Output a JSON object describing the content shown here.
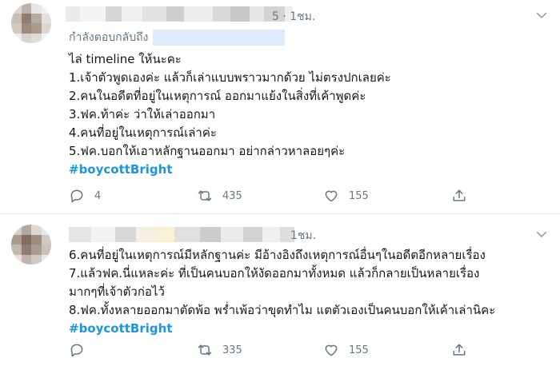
{
  "tweets": [
    {
      "time": "5 · 1ชม.",
      "replying_to": "กำลังตอบกลับถึง",
      "lines": [
        "ไล่ timeline ให้นะคะ",
        "1.เจ้าตัวพูดเองค่ะ แล้วก็เล่าแบบพราวมากด้วย ไม่ตรงปกเลยค่ะ",
        "2.คนในอดีตที่อยู่ในเหตุการณ์ ออกมาแย้งในสิ่งที่เค้าพูดค่ะ",
        "3.ฟค.ท้าค่ะ ว่าให้เล่าออกมา",
        "4.คนที่อยู่ในเหตุการณ์เล่าค่ะ",
        "5.ฟค.บอกให้เอาหลักฐานออกมา อย่ากล่าวหาลอยๆค่ะ"
      ],
      "hashtag": "#boycottBright",
      "reply_count": "4",
      "retweet_count": "435",
      "like_count": "155",
      "icons": {
        "reply": "reply-icon",
        "retweet": "retweet-icon",
        "like": "heart-icon",
        "share": "share-icon",
        "menu": "chevron-down-icon"
      }
    },
    {
      "time": "1ชม.",
      "lines": [
        "6.คนที่อยู่ในเหตุการณ์มีหลักฐานค่ะ มีอ้างอิงถึงเหตุการณ์อื่นๆในอดีตอีกหลายเรื่อง",
        "7.แล้วฟค.นี่แหละค่ะ ที่เป็นคนบอกให้งัดออกมาทั้งหมด แล้วก็กลายเป็นหลายเรื่อง",
        "มากๆที่เจ้าตัวก่อไว้",
        "8.ฟค.ทั้งหลายออกมาตัดพ้อ พร่ำเพ้อว่าขุดทำไม แตตัวเองเป็นคนบอกให้เค้าเล่านิคะ"
      ],
      "hashtag": "#boycottBright",
      "reply_count": "",
      "retweet_count": "335",
      "like_count": "155",
      "icons": {
        "reply": "reply-icon",
        "retweet": "retweet-icon",
        "like": "heart-icon",
        "share": "share-icon",
        "menu": "chevron-down-icon"
      }
    }
  ],
  "colors": {
    "link": "#1b95e0",
    "muted": "#657786",
    "text": "#14171a",
    "divider": "#e6ecf0"
  }
}
